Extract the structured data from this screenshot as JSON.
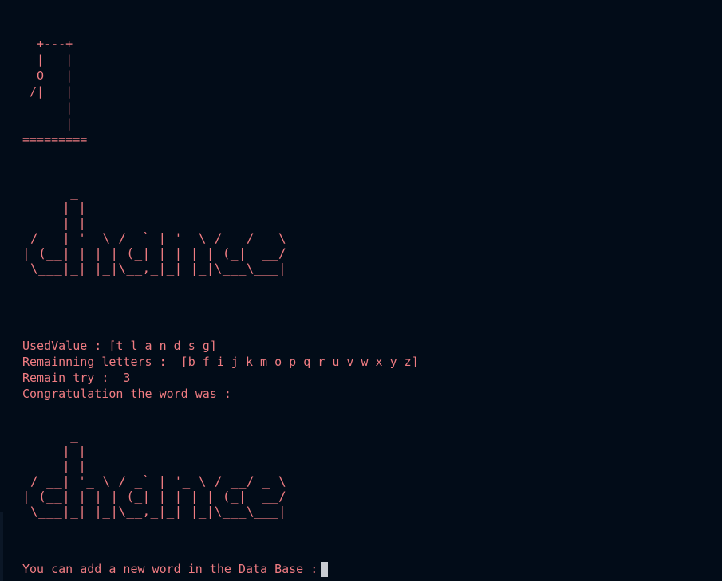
{
  "gallows_art": "  +---+\n  |   |\n  O   |\n /|   |\n      |\n      |\n=========",
  "word_art": "      _\n     | |\n  ___| |__   __ _ _ __   ___ ___\n / __| '_ \\ / _` | '_ \\ / __/ _ \\\n| (__| | | | (_| | | | | (_|  __/\n \\___|_| |_|\\__,_|_| |_|\\___\\___|",
  "status": {
    "used_value": "UsedValue : [t l a n d s g]",
    "remaining_letters": "Remainning letters :  [b f i j k m o p q r u v w x y z]",
    "remain_try": "Remain try :  3",
    "congratulation": "Congratulation the word was :"
  },
  "prompt": {
    "text": "You can add a new word in the Data Base :"
  },
  "colors": {
    "background": "#020c18",
    "text": "#f07c82",
    "cursor": "#c8ccd2"
  }
}
